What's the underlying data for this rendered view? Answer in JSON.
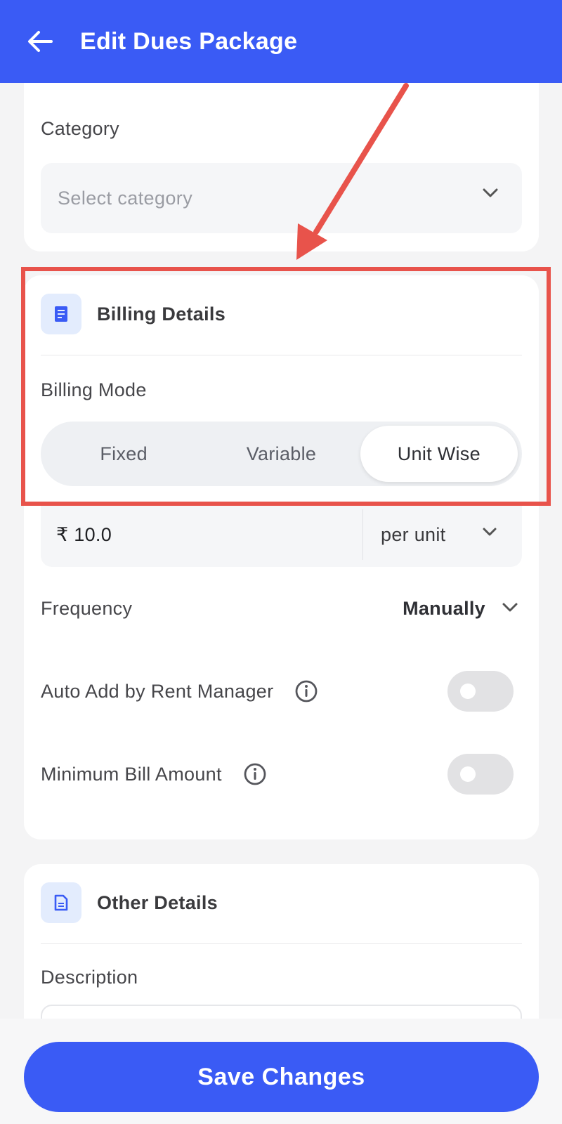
{
  "header": {
    "title": "Edit Dues Package"
  },
  "category": {
    "label": "Category",
    "placeholder": "Select category"
  },
  "billing": {
    "title": "Billing Details",
    "mode_label": "Billing Mode",
    "modes": [
      "Fixed",
      "Variable",
      "Unit Wise"
    ],
    "selected_mode": "Unit Wise",
    "price_value": "₹ 10.0",
    "unit": "per unit",
    "frequency_label": "Frequency",
    "frequency_value": "Manually",
    "auto_add_label": "Auto Add by Rent Manager",
    "auto_add_enabled": false,
    "min_bill_label": "Minimum Bill Amount",
    "min_bill_enabled": false
  },
  "other": {
    "title": "Other Details",
    "description_label": "Description"
  },
  "footer": {
    "save_label": "Save Changes"
  },
  "colors": {
    "primary": "#3a5bf5",
    "annotation": "#e8534b",
    "icon_bg": "#e3ecfd"
  },
  "icons": [
    "back-arrow-icon",
    "chevron-down-icon",
    "receipt-icon",
    "info-icon",
    "document-icon"
  ]
}
